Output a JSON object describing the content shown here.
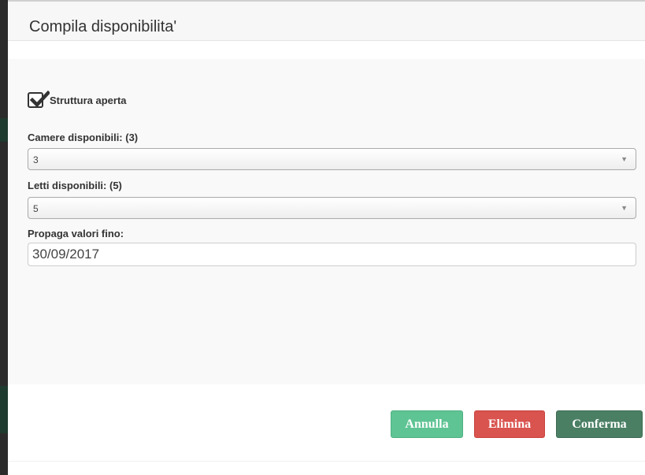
{
  "modal": {
    "title": "Compila disponibilita'"
  },
  "form": {
    "checkbox_label": "Struttura aperta",
    "checkbox_checked": true,
    "rooms_label": "Camere disponibili: (3)",
    "rooms_value": "3",
    "beds_label": "Letti disponibili: (5)",
    "beds_value": "5",
    "propagate_label": "Propaga valori fino:",
    "propagate_value": "30/09/2017"
  },
  "buttons": {
    "cancel": "Annulla",
    "delete": "Elimina",
    "confirm": "Conferma"
  },
  "colors": {
    "cancel": "#5fc494",
    "delete": "#d9534f",
    "confirm": "#4a7f64"
  },
  "icons": {
    "checkmark": "checkmark-icon",
    "dropdown": "chevron-down-icon"
  }
}
